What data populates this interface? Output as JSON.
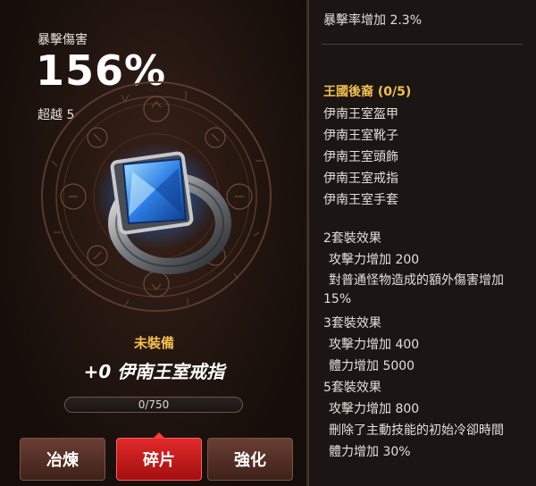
{
  "stat": {
    "label": "暴擊傷害",
    "value": "156%",
    "exceed": "超越 5"
  },
  "item": {
    "status": "未裝備",
    "name": "+0 伊南王室戒指",
    "progress_text": "0/750",
    "progress_fraction": 0.0
  },
  "buttons": {
    "refine": "冶煉",
    "shard": "碎片",
    "enhance": "強化"
  },
  "panel": {
    "top_line": "暴擊率增加 2.3%",
    "set_title": "王國後裔 (0/5)",
    "set_items": [
      "伊南王室盔甲",
      "伊南王室靴子",
      "伊南王室頭飾",
      "伊南王室戒指",
      "伊南王室手套"
    ],
    "bonus2_title": "2套裝效果",
    "bonus2_lines": [
      "攻擊力增加 200",
      "對普通怪物造成的額外傷害增加",
      "15%"
    ],
    "bonus3_title": "3套裝效果",
    "bonus3_lines": [
      "攻擊力增加 400",
      "體力增加 5000"
    ],
    "bonus5_title": "5套裝效果",
    "bonus5_lines": [
      "攻擊力增加 800",
      "刪除了主動技能的初始冷卻時間",
      "體力增加 30%"
    ]
  },
  "colors": {
    "gold": "#f2c14e",
    "accent_red": "#d11e1e",
    "gem_blue": "#2e7fe6"
  }
}
